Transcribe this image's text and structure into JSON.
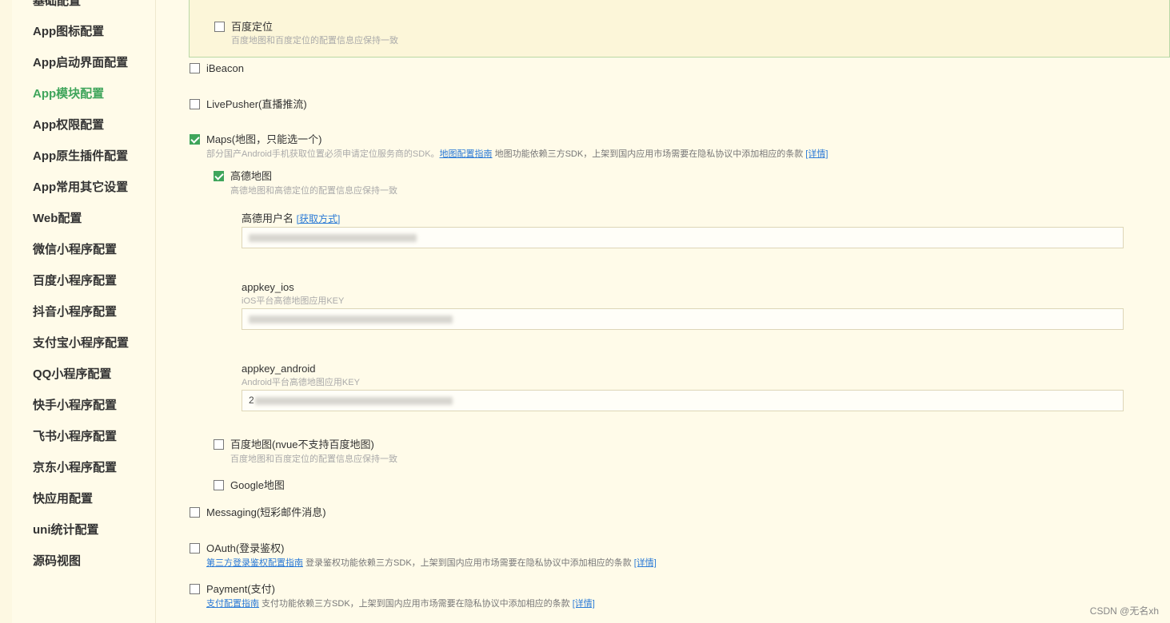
{
  "sidebar": {
    "items": [
      {
        "label": "基础配置",
        "active": false
      },
      {
        "label": "App图标配置",
        "active": false
      },
      {
        "label": "App启动界面配置",
        "active": false
      },
      {
        "label": "App模块配置",
        "active": true
      },
      {
        "label": "App权限配置",
        "active": false
      },
      {
        "label": "App原生插件配置",
        "active": false
      },
      {
        "label": "App常用其它设置",
        "active": false
      },
      {
        "label": "Web配置",
        "active": false
      },
      {
        "label": "微信小程序配置",
        "active": false
      },
      {
        "label": "百度小程序配置",
        "active": false
      },
      {
        "label": "抖音小程序配置",
        "active": false
      },
      {
        "label": "支付宝小程序配置",
        "active": false
      },
      {
        "label": "QQ小程序配置",
        "active": false
      },
      {
        "label": "快手小程序配置",
        "active": false
      },
      {
        "label": "飞书小程序配置",
        "active": false
      },
      {
        "label": "京东小程序配置",
        "active": false
      },
      {
        "label": "快应用配置",
        "active": false
      },
      {
        "label": "uni统计配置",
        "active": false
      },
      {
        "label": "源码视图",
        "active": false
      }
    ]
  },
  "modules": {
    "baidu_location": {
      "label": "百度定位",
      "checked": false,
      "desc": "百度地图和百度定位的配置信息应保持一致"
    },
    "ibeacon": {
      "label": "iBeacon",
      "checked": false
    },
    "livepusher": {
      "label": "LivePusher(直播推流)",
      "checked": false
    },
    "maps": {
      "label": "Maps(地图，只能选一个)",
      "checked": true,
      "desc": "部分国产Android手机获取位置必须申请定位服务商的SDK。",
      "guide_link": "地图配置指南",
      "note": " 地图功能依赖三方SDK，上架到国内应用市场需要在隐私协议中添加相应的条款 ",
      "detail_link": "[详情]",
      "amap": {
        "label": "高德地图",
        "checked": true,
        "desc": "高德地图和高德定位的配置信息应保持一致",
        "username_label": "高德用户名",
        "username_link": "[获取方式]",
        "appkey_ios_label": "appkey_ios",
        "appkey_ios_desc": "iOS平台高德地图应用KEY",
        "appkey_android_label": "appkey_android",
        "appkey_android_desc": "Android平台高德地图应用KEY",
        "appkey_android_prefix": "2"
      },
      "baidu_map": {
        "label": "百度地图(nvue不支持百度地图)",
        "checked": false,
        "desc": "百度地图和百度定位的配置信息应保持一致"
      },
      "google_map": {
        "label": "Google地图",
        "checked": false
      }
    },
    "messaging": {
      "label": "Messaging(短彩邮件消息)",
      "checked": false
    },
    "oauth": {
      "label": "OAuth(登录鉴权)",
      "checked": false,
      "guide_link": "第三方登录鉴权配置指南",
      "note": " 登录鉴权功能依赖三方SDK，上架到国内应用市场需要在隐私协议中添加相应的条款 ",
      "detail_link": "[详情]"
    },
    "payment": {
      "label": "Payment(支付)",
      "checked": false,
      "guide_link": "支付配置指南",
      "note": " 支付功能依赖三方SDK，上架到国内应用市场需要在隐私协议中添加相应的条款 ",
      "detail_link": "[详情]"
    }
  },
  "watermark": "CSDN @无名xh",
  "colors": {
    "accent": "#3fa55b",
    "link": "#2a7ad6",
    "background": "#fffbe9"
  }
}
